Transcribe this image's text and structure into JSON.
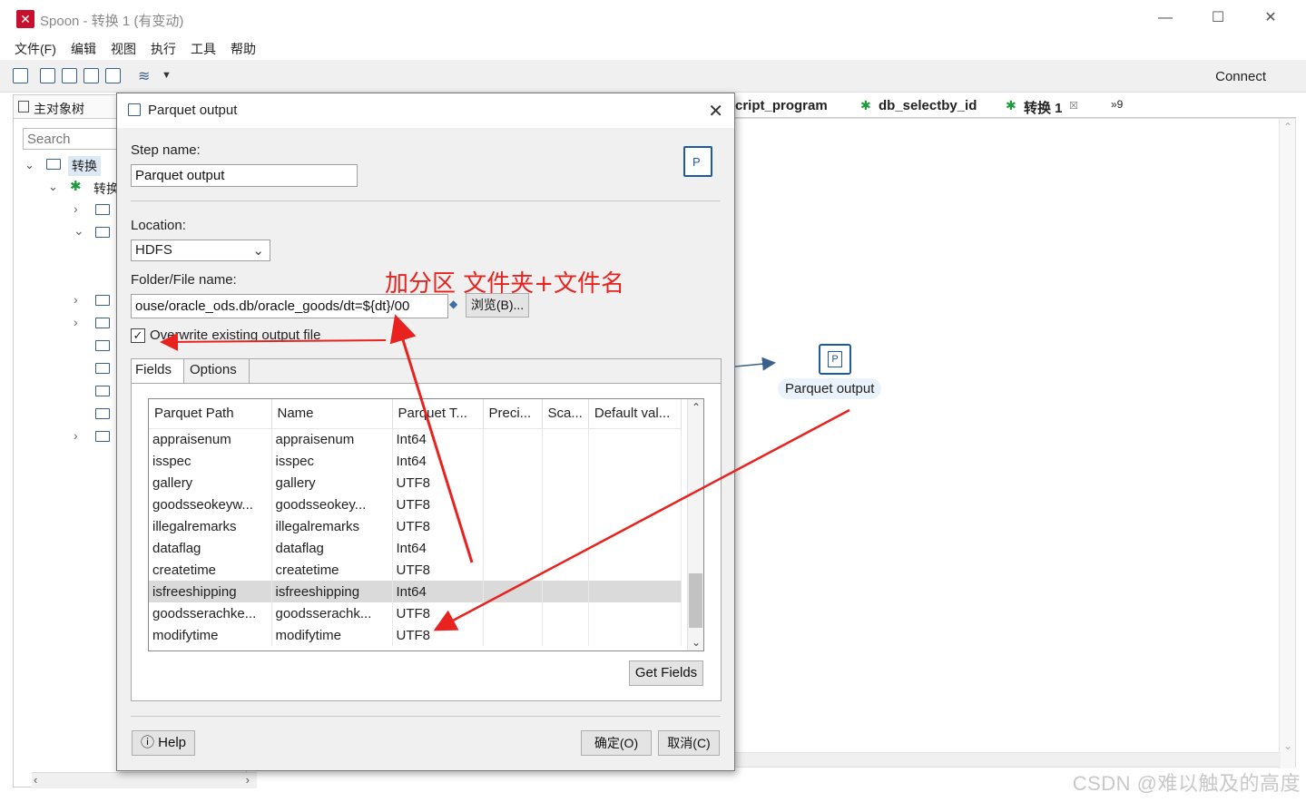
{
  "window": {
    "app_icon": "spoon-icon",
    "title": "Spoon - 转换 1 (有变动)",
    "minimize": "—",
    "maximize": "☐",
    "close": "✕"
  },
  "menu": [
    "文件(F)",
    "编辑",
    "视图",
    "执行",
    "工具",
    "帮助"
  ],
  "toolbar": {
    "connect_label": "Connect"
  },
  "left_panel": {
    "tab_label": "主对象树",
    "search_placeholder": "Search",
    "tree_root": "转换",
    "tree_child": "转换"
  },
  "tabs": [
    "cript_program",
    "db_selectby_id",
    "转换 1",
    "»9"
  ],
  "canvas": {
    "step_label": "Parquet output"
  },
  "dialog": {
    "title": "Parquet output",
    "step_name_label": "Step name:",
    "step_name_value": "Parquet output",
    "location_label": "Location:",
    "location_value": "HDFS",
    "folder_label": "Folder/File name:",
    "folder_value": "ouse/oracle_ods.db/oracle_goods/dt=${dt}/00",
    "browse_label": "浏览(B)...",
    "overwrite_label": "Overwrite existing output file",
    "overwrite_checked": "✓",
    "tab_fields": "Fields",
    "tab_options": "Options",
    "columns": [
      "Parquet Path",
      "Name",
      "Parquet T...",
      "Preci...",
      "Sca...",
      "Default val..."
    ],
    "rows": [
      [
        "appraisenum",
        "appraisenum",
        "Int64",
        "",
        "",
        ""
      ],
      [
        "isspec",
        "isspec",
        "Int64",
        "",
        "",
        ""
      ],
      [
        "gallery",
        "gallery",
        "UTF8",
        "",
        "",
        ""
      ],
      [
        "goodsseokeyw...",
        "goodsseokey...",
        "UTF8",
        "",
        "",
        ""
      ],
      [
        "illegalremarks",
        "illegalremarks",
        "UTF8",
        "",
        "",
        ""
      ],
      [
        "dataflag",
        "dataflag",
        "Int64",
        "",
        "",
        ""
      ],
      [
        "createtime",
        "createtime",
        "UTF8",
        "",
        "",
        ""
      ],
      [
        "isfreeshipping",
        "isfreeshipping",
        "Int64",
        "",
        "",
        ""
      ],
      [
        "goodsserachke...",
        "goodsserachk...",
        "UTF8",
        "",
        "",
        ""
      ],
      [
        "modifytime",
        "modifytime",
        "UTF8",
        "",
        "",
        ""
      ]
    ],
    "selected_row": 7,
    "get_fields_label": "Get Fields",
    "help_label": "Help",
    "ok_label": "确定(O)",
    "cancel_label": "取消(C)"
  },
  "annotation": {
    "text": "加分区 文件夹+文件名",
    "color": "#e8231f"
  },
  "watermark": "CSDN @难以触及的高度"
}
